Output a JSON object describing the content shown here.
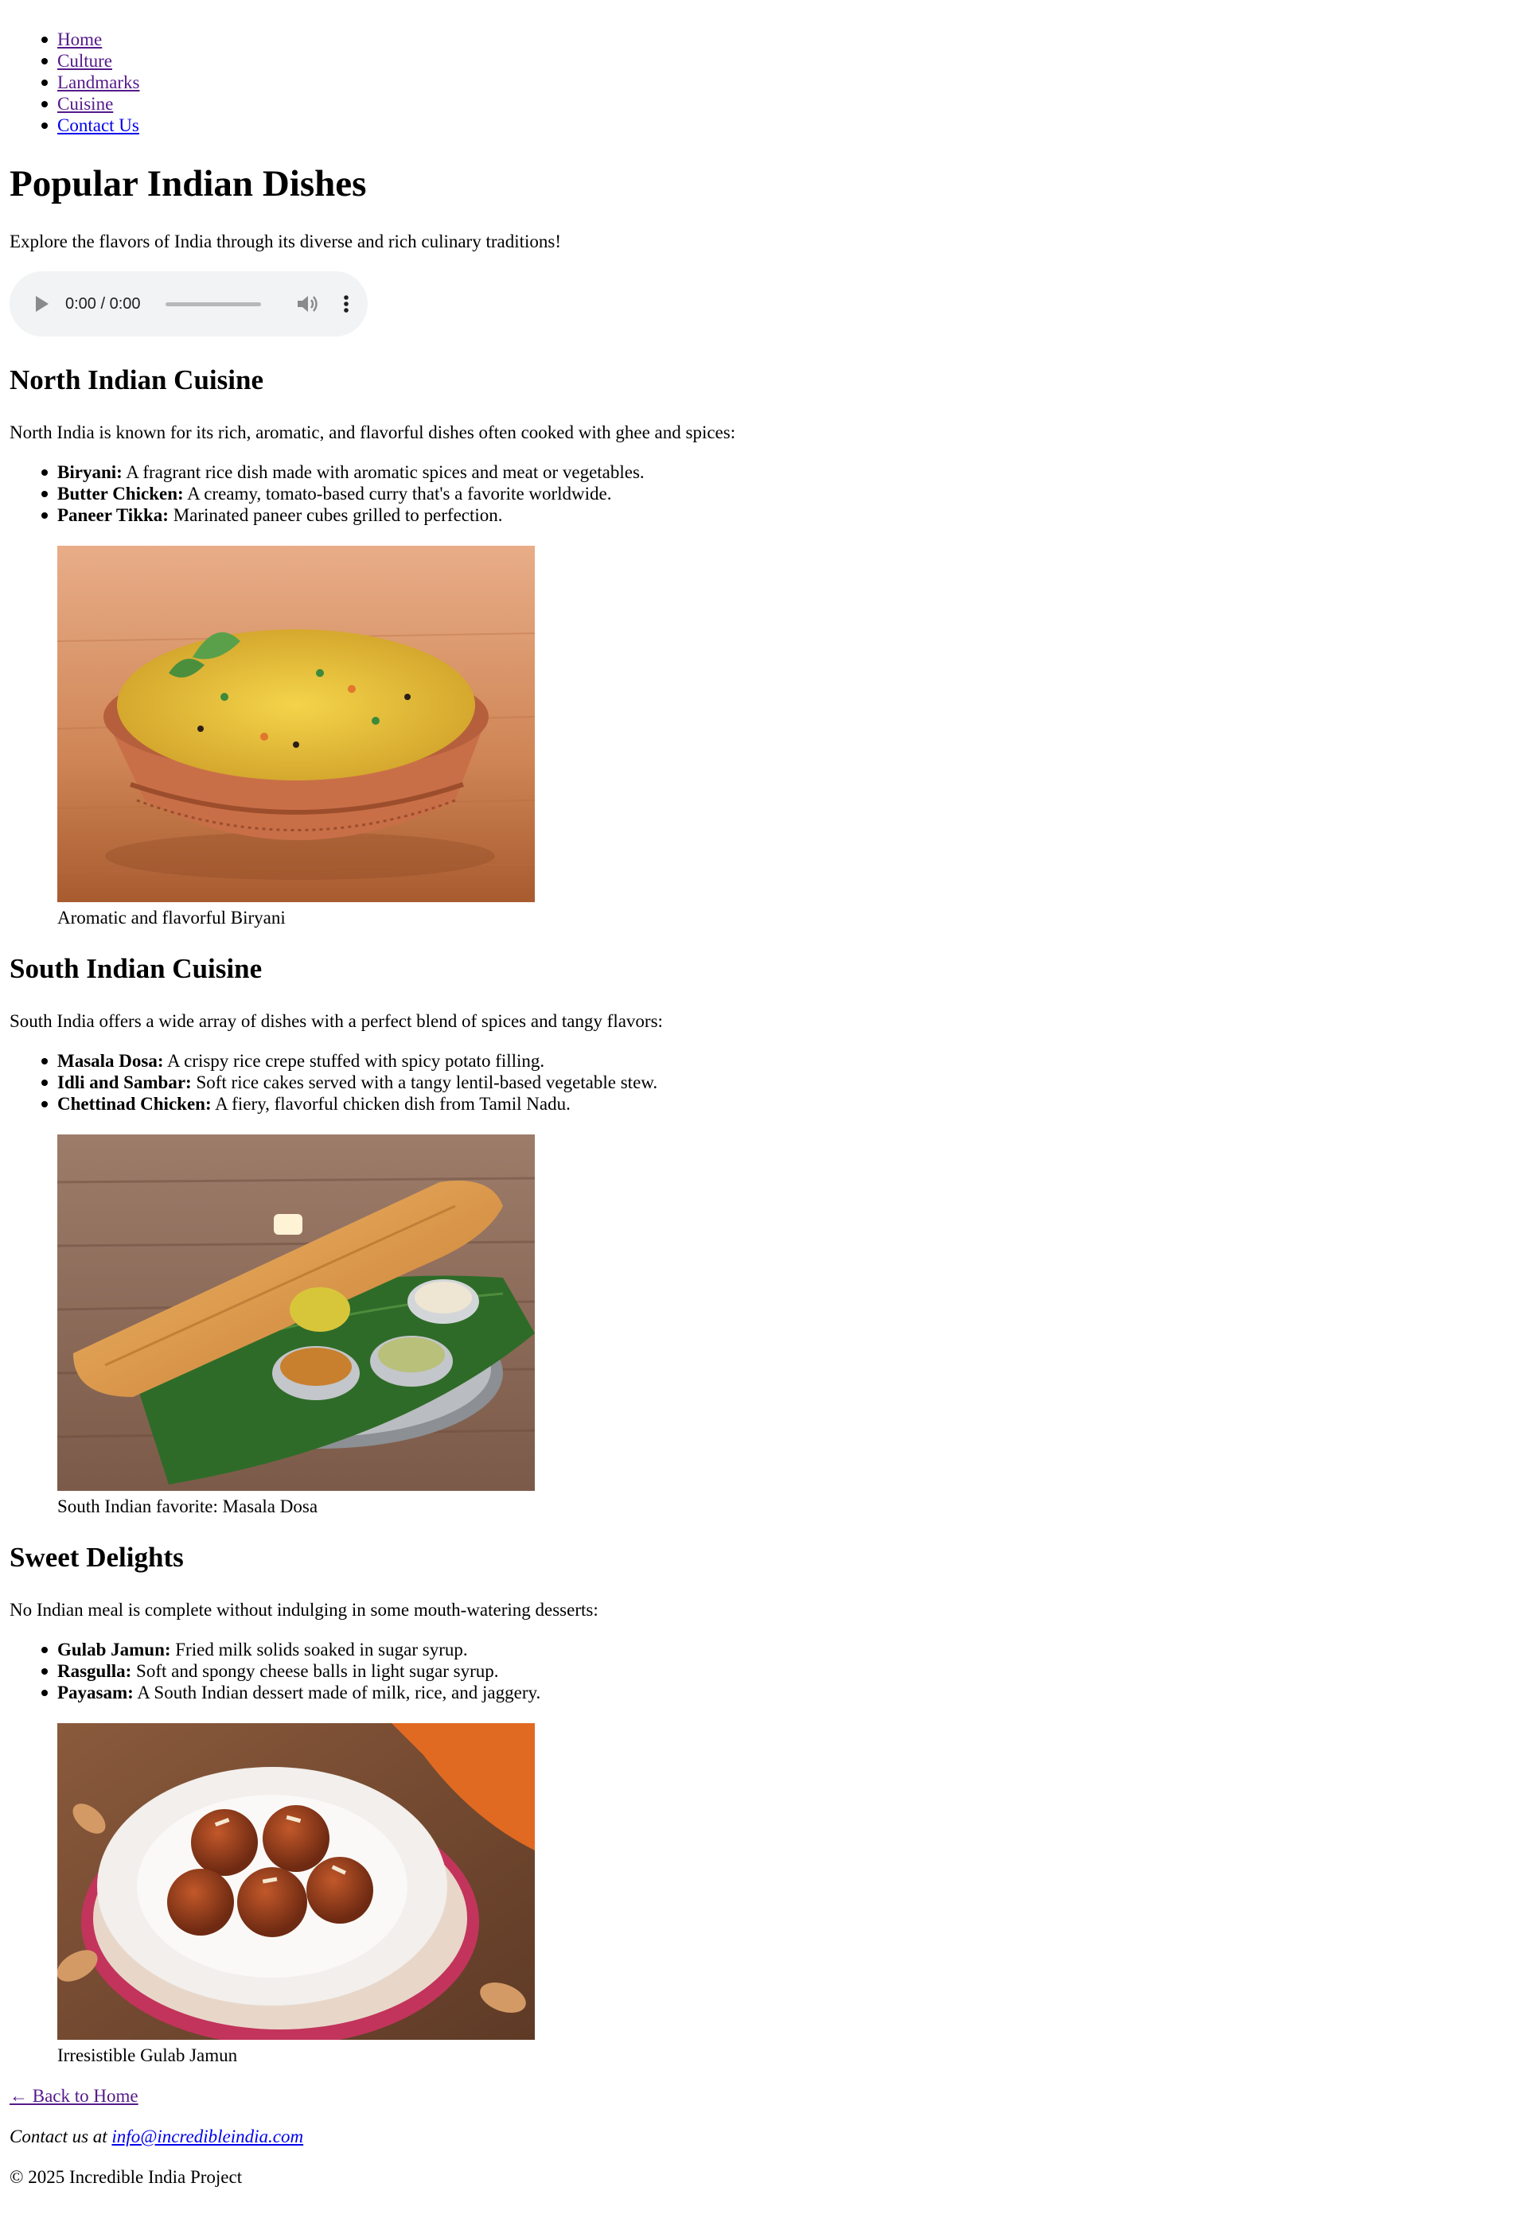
{
  "nav": {
    "items": [
      {
        "label": "Home"
      },
      {
        "label": "Culture"
      },
      {
        "label": "Landmarks"
      },
      {
        "label": "Cuisine"
      },
      {
        "label": "Contact Us"
      }
    ]
  },
  "header": {
    "title": "Popular Indian Dishes",
    "intro": "Explore the flavors of India through its diverse and rich culinary traditions!"
  },
  "audio": {
    "time": "0:00 / 0:00",
    "play_icon": "play-icon",
    "volume_icon": "volume-icon",
    "more_icon": "more-options-icon",
    "progress": 0
  },
  "sections": [
    {
      "title": "North Indian Cuisine",
      "description": "North India is known for its rich, aromatic, and flavorful dishes often cooked with ghee and spices:",
      "dishes": [
        {
          "name": "Biryani:",
          "description": " A fragrant rice dish made with aromatic spices and meat or vegetables."
        },
        {
          "name": "Butter Chicken:",
          "description": " A creamy, tomato-based curry that's a favorite worldwide."
        },
        {
          "name": "Paneer Tikka:",
          "description": " Marinated paneer cubes grilled to perfection."
        }
      ],
      "caption": "Aromatic and flavorful Biryani"
    },
    {
      "title": "South Indian Cuisine",
      "description": "South India offers a wide array of dishes with a perfect blend of spices and tangy flavors:",
      "dishes": [
        {
          "name": "Masala Dosa:",
          "description": " A crispy rice crepe stuffed with spicy potato filling."
        },
        {
          "name": "Idli and Sambar:",
          "description": " Soft rice cakes served with a tangy lentil-based vegetable stew."
        },
        {
          "name": "Chettinad Chicken:",
          "description": " A fiery, flavorful chicken dish from Tamil Nadu."
        }
      ],
      "caption": "South Indian favorite: Masala Dosa"
    },
    {
      "title": "Sweet Delights",
      "description": "No Indian meal is complete without indulging in some mouth-watering desserts:",
      "dishes": [
        {
          "name": "Gulab Jamun:",
          "description": " Fried milk solids soaked in sugar syrup."
        },
        {
          "name": "Rasgulla:",
          "description": " Soft and spongy cheese balls in light sugar syrup."
        },
        {
          "name": "Payasam:",
          "description": " A South Indian dessert made of milk, rice, and jaggery."
        }
      ],
      "caption": "Irresistible Gulab Jamun"
    }
  ],
  "footer": {
    "back_link": "← Back to Home",
    "contact_prefix": "Contact us at ",
    "email": "info@incredibleindia.com",
    "copyright": "© 2025 Incredible India Project"
  },
  "colors": {
    "visited_link": "#551a8b",
    "unvisited_link": "#0000ee",
    "audio_background": "#f1f3f4"
  }
}
